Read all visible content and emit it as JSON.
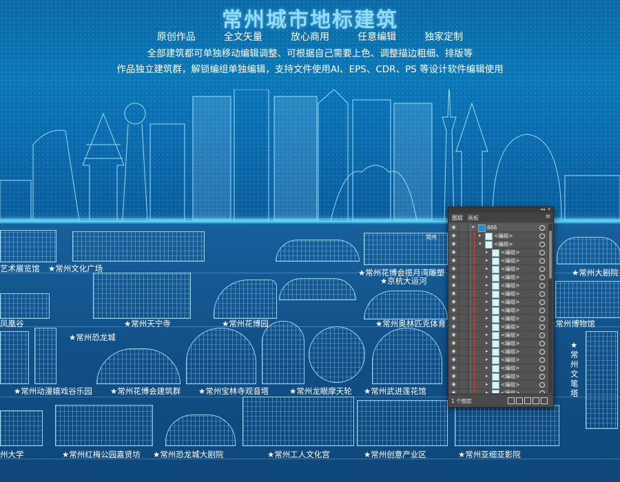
{
  "hero": {
    "title": "常州城市地标建筑",
    "features": [
      "原创作品",
      "全文矢量",
      "放心商用",
      "任意编辑",
      "独家定制"
    ],
    "description_line1": "全部建筑都可单独移动编辑调整、可根据自己需要上色、调整描边粗细、排版等",
    "description_line2": "作品独立建筑群，解锁编组单独编辑，支持文件使用AI、EPS、CDR、PS 等设计软件编辑使用"
  },
  "landmarks": {
    "row1": [
      "艺术展览馆",
      "★常州文化广场",
      "★常州花博会揽月湾雕塑",
      "★京杭大运河",
      "★常州大剧院"
    ],
    "row2": [
      "凤凰谷",
      "★常州天宁寺",
      "★常州花博园",
      "★常州奥林匹克体育",
      "★常州博物馆"
    ],
    "row3": [
      "★常州恐龙城",
      "★常州动漫嬉戏谷乐园",
      "★常州花博会建筑群",
      "★常州宝林寺观音塔",
      "★常州龙眼摩天轮",
      "★常州武进莲花馆"
    ],
    "row3_vertical": "★常州文笔塔",
    "row4": [
      "州大学",
      "★常州红梅公园嘉贤坊",
      "★常州恐龙城大剧院",
      "★常州工人文化宫",
      "★常州创意产业区",
      "★常州亚细亚影院"
    ],
    "sign_text": "常州"
  },
  "layers_panel": {
    "tabs": [
      "图层",
      "画板"
    ],
    "top_layer": "666",
    "group_label": "<编组>",
    "rows": [
      {
        "label": "666",
        "indent": 0,
        "expanded": true,
        "top": true
      },
      {
        "label": "<编组>",
        "indent": 1,
        "expanded": false
      },
      {
        "label": "<编组>",
        "indent": 1,
        "expanded": true
      },
      {
        "label": "<编组>",
        "indent": 2
      },
      {
        "label": "<编组>",
        "indent": 2
      },
      {
        "label": "<编组>",
        "indent": 2
      },
      {
        "label": "<编组>",
        "indent": 2
      },
      {
        "label": "<编组>",
        "indent": 2
      },
      {
        "label": "<编组>",
        "indent": 2
      },
      {
        "label": "<编组>",
        "indent": 2
      },
      {
        "label": "<编组>",
        "indent": 2
      },
      {
        "label": "<编组>",
        "indent": 2
      },
      {
        "label": "<编组>",
        "indent": 2
      },
      {
        "label": "<编组>",
        "indent": 2
      },
      {
        "label": "<编组>",
        "indent": 2
      },
      {
        "label": "<编组>",
        "indent": 2
      },
      {
        "label": "<编组>",
        "indent": 2
      },
      {
        "label": "<编组>",
        "indent": 2
      },
      {
        "label": "<编组>",
        "indent": 2
      },
      {
        "label": "<编组>",
        "indent": 2
      },
      {
        "label": "<编组>",
        "indent": 2
      }
    ],
    "footer": "1 个图层",
    "colors": {
      "panel_bg": "#535353",
      "selection_line": "#d44444",
      "accent": "#1e8fd6"
    }
  },
  "colors": {
    "background": "#0b4f86",
    "line_art": "#aae6ff",
    "title": "#8fdcff"
  }
}
